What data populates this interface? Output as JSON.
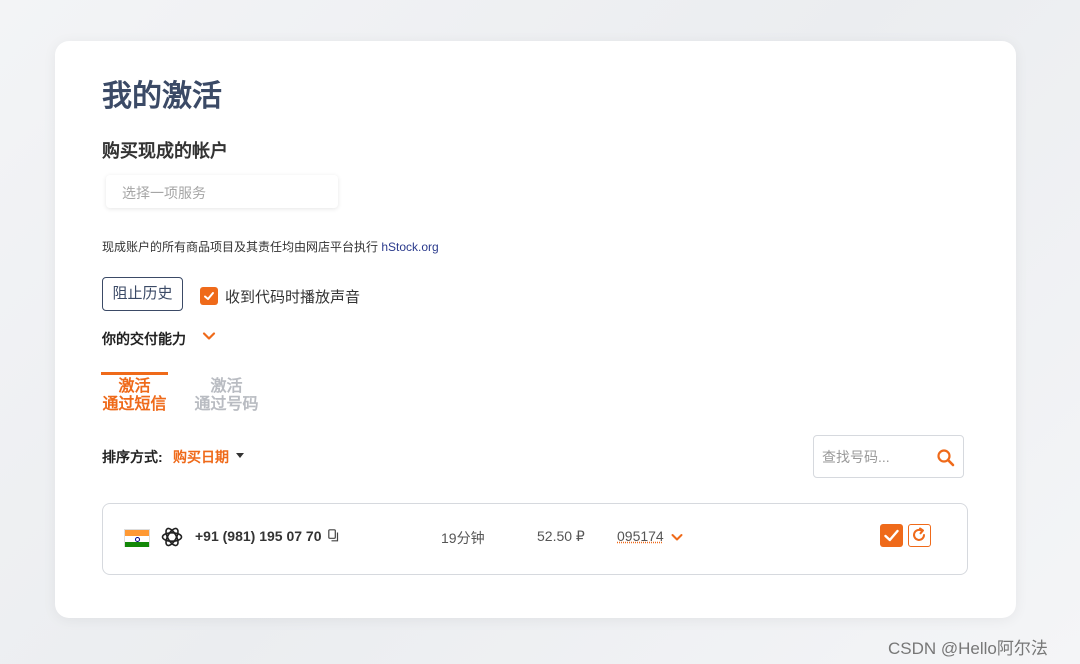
{
  "page": {
    "title": "我的激活",
    "subtitle": "购买现成的帐户"
  },
  "service_select": {
    "placeholder": "选择一项服务"
  },
  "notice": {
    "text": "现成账户的所有商品项目及其责任均由网店平台执行 ",
    "link": "hStock.org"
  },
  "controls": {
    "block_history": "阻止历史",
    "sound_label": "收到代码时播放声音",
    "sound_checked": true,
    "capacity_label": "你的交付能力"
  },
  "tabs": [
    {
      "line1": "激活",
      "line2": "通过短信",
      "active": true
    },
    {
      "line1": "激活",
      "line2": "通过号码",
      "active": false
    }
  ],
  "sort": {
    "label": "排序方式:",
    "value": "购买日期"
  },
  "search": {
    "placeholder": "查找号码..."
  },
  "activations": [
    {
      "country_flag": "india-flag",
      "service_icon": "openai-icon",
      "phone": "+91 (981) 195 07 70",
      "duration": "19分钟",
      "price": "52.50 ₽",
      "code": "095174"
    }
  ],
  "colors": {
    "accent": "#ef6a1a",
    "title": "#3b4a66",
    "link": "#2a3a8c"
  },
  "watermark": "CSDN @Hello阿尔法"
}
